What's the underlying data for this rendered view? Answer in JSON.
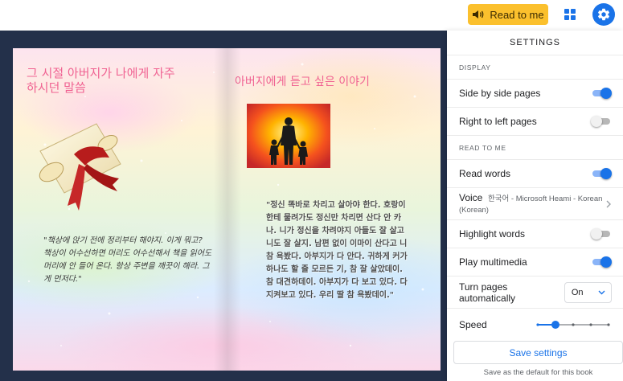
{
  "toolbar": {
    "read_to_me_label": "Read to me",
    "accent_color": "#fbc02d",
    "settings_button_color": "#1a73e8",
    "icons": [
      "speaker-icon",
      "grid-icon",
      "gear-icon"
    ]
  },
  "book": {
    "left_title": "그 시절 아버지가 나에게 자주 하시던 말씀",
    "left_quote": "\"책상에 앉기 전에 정리부터 해야지. 이게 뭐고? 책상이 어수선하면 머리도 어수선해서 책을 읽어도 머리에 안 들어 온다. 항상 주변을 깨끗이 해라. 그게 먼저다.\"",
    "right_title": "아버지에게 듣고 싶은 이야기",
    "right_quote": "\"정신 똑바로 차리고 살아야 한다. 호랑이한테 물려가도 정신만 차리면 산다 안 카나. 니가 정신을 차려야지 아들도 잘 살고 니도 잘 살지. 남편 없이 이마이 산다고 니 참 욕봤다. 아부지가 다 안다. 귀하게 커가 하나도 할 줄 모르든 기, 참 잘 살았데이. 참 대견하데이. 아부지가 다 보고 있다. 다 지켜보고 있다. 우리 딸 참 욕봤데이.\"",
    "title_color": "#f06292"
  },
  "settings": {
    "title": "SETTINGS",
    "display_section": "DISPLAY",
    "side_by_side": {
      "label": "Side by side pages",
      "on": true
    },
    "right_to_left": {
      "label": "Right to left pages",
      "on": false
    },
    "read_section": "READ TO ME",
    "read_words": {
      "label": "Read words",
      "on": true
    },
    "voice": {
      "label": "Voice",
      "value": "한국어 - Microsoft Heami - Korean (Korean)"
    },
    "highlight_words": {
      "label": "Highlight words",
      "on": false
    },
    "play_multimedia": {
      "label": "Play multimedia",
      "on": true
    },
    "turn_pages": {
      "label": "Turn pages automatically",
      "value": "On"
    },
    "speed": {
      "label": "Speed",
      "level": 1,
      "steps": 5
    },
    "save_button": "Save settings",
    "save_note": "Save as the default for this book",
    "toggle_on_color": "#1a73e8"
  }
}
